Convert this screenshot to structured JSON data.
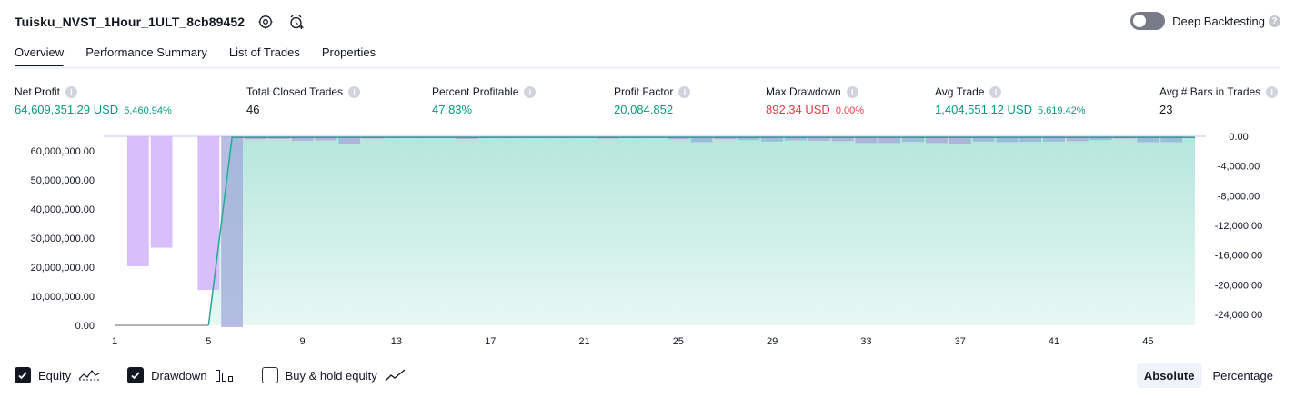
{
  "header": {
    "strategy_title": "Tuisku_NVST_1Hour_1ULT_8cb89452",
    "deep_backtesting_label": "Deep Backtesting",
    "help_glyph": "?"
  },
  "tabs": [
    {
      "label": "Overview",
      "active": true
    },
    {
      "label": "Performance Summary",
      "active": false
    },
    {
      "label": "List of Trades",
      "active": false
    },
    {
      "label": "Properties",
      "active": false
    }
  ],
  "metrics": [
    {
      "label": "Net Profit",
      "value": "64,609,351.29 USD",
      "sub": "6,460.94%",
      "color": "#089981"
    },
    {
      "label": "Total Closed Trades",
      "value": "46",
      "sub": "",
      "color": "#131722"
    },
    {
      "label": "Percent Profitable",
      "value": "47.83%",
      "sub": "",
      "color": "#089981"
    },
    {
      "label": "Profit Factor",
      "value": "20,084.852",
      "sub": "",
      "color": "#089981"
    },
    {
      "label": "Max Drawdown",
      "value": "892.34 USD",
      "sub": "0.00%",
      "color": "#f23645"
    },
    {
      "label": "Avg Trade",
      "value": "1,404,551.12 USD",
      "sub": "5,619.42%",
      "color": "#089981"
    },
    {
      "label": "Avg # Bars in Trades",
      "value": "23",
      "sub": "",
      "color": "#131722"
    }
  ],
  "info_glyph": "i",
  "colors": {
    "equity_line": "#22ab94",
    "equity_fill": "#b2e5da",
    "drawdown_bar": "#d4b8fb",
    "drawdown_bar_alt": "#9fa8da",
    "profit": "#089981",
    "loss": "#f23645"
  },
  "chart_data": {
    "type": "area",
    "equity": {
      "name": "Equity",
      "x": [
        1,
        2,
        3,
        4,
        5,
        6,
        7,
        8,
        9,
        10,
        11,
        12,
        13,
        14,
        15,
        16,
        17,
        18,
        19,
        20,
        21,
        22,
        23,
        24,
        25,
        26,
        27,
        28,
        29,
        30,
        31,
        32,
        33,
        34,
        35,
        36,
        37,
        38,
        39,
        40,
        41,
        42,
        43,
        44,
        45,
        46,
        47
      ],
      "values": [
        0,
        0,
        0,
        0,
        0,
        64600000,
        64600000,
        64600000,
        64600000,
        64600000,
        64600000,
        64600000,
        64600000,
        64600000,
        64600000,
        64600000,
        64600000,
        64600000,
        64600000,
        64600000,
        64600000,
        64600000,
        64600000,
        64600000,
        64600000,
        64600000,
        64600000,
        64600000,
        64600000,
        64600000,
        64600000,
        64600000,
        64600000,
        64600000,
        64600000,
        64600000,
        64600000,
        64600000,
        64600000,
        64600000,
        64600000,
        64600000,
        64600000,
        64600000,
        64600000,
        64600000,
        64600000
      ],
      "ylim": [
        -2000000,
        65000000
      ],
      "yticks": [
        "60,000,000.00",
        "50,000,000.00",
        "40,000,000.00",
        "30,000,000.00",
        "20,000,000.00",
        "10,000,000.00",
        "0.00"
      ],
      "ytick_values": [
        60000000,
        50000000,
        40000000,
        30000000,
        20000000,
        10000000,
        0
      ]
    },
    "drawdown": {
      "name": "Drawdown",
      "x": [
        2,
        3,
        5,
        6,
        7,
        8,
        9,
        10,
        11,
        12,
        13,
        14,
        15,
        16,
        17,
        18,
        19,
        20,
        21,
        22,
        23,
        24,
        25,
        26,
        27,
        28,
        29,
        30,
        31,
        32,
        33,
        34,
        35,
        36,
        37,
        38,
        39,
        40,
        41,
        42,
        43,
        44,
        45,
        46
      ],
      "values": [
        -17500,
        -15000,
        -20700,
        -25700,
        -400,
        -350,
        -600,
        -550,
        -1000,
        -300,
        -250,
        -200,
        -200,
        -350,
        -200,
        -150,
        -150,
        -250,
        -200,
        -300,
        -200,
        -200,
        -400,
        -800,
        -400,
        -500,
        -700,
        -550,
        -600,
        -650,
        -900,
        -900,
        -750,
        -900,
        -1000,
        -700,
        -800,
        -750,
        -700,
        -650,
        -500,
        -300,
        -800,
        -800
      ],
      "ylim": [
        -25700,
        400
      ],
      "yticks": [
        "0.00",
        "-4,000.00",
        "-8,000.00",
        "-12,000.00",
        "-16,000.00",
        "-20,000.00",
        "-24,000.00"
      ],
      "ytick_values": [
        0,
        -4000,
        -8000,
        -12000,
        -16000,
        -20000,
        -24000
      ]
    },
    "xticks": [
      "1",
      "5",
      "9",
      "13",
      "17",
      "21",
      "25",
      "29",
      "33",
      "37",
      "41",
      "45"
    ],
    "xtick_values": [
      1,
      5,
      9,
      13,
      17,
      21,
      25,
      29,
      33,
      37,
      41,
      45
    ],
    "xlim": [
      1,
      47
    ]
  },
  "legend": [
    {
      "label": "Equity",
      "checked": true,
      "icon": "equity-line-icon"
    },
    {
      "label": "Drawdown",
      "checked": true,
      "icon": "drawdown-bars-icon"
    },
    {
      "label": "Buy & hold equity",
      "checked": false,
      "icon": "buy-hold-line-icon"
    }
  ],
  "mode": {
    "absolute_label": "Absolute",
    "percentage_label": "Percentage",
    "active": "absolute"
  }
}
